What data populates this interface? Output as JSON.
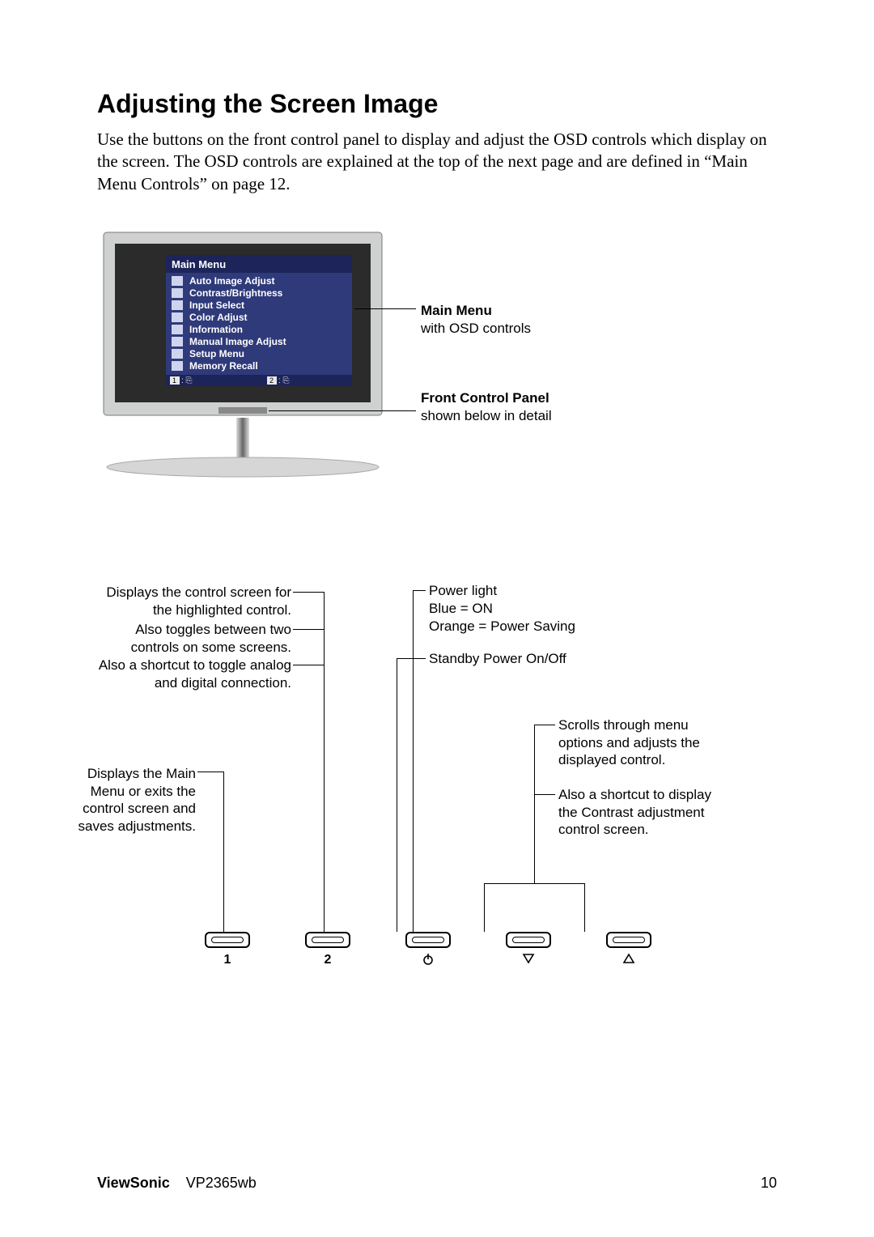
{
  "title": "Adjusting the Screen Image",
  "intro": "Use the buttons on the front control panel to display and adjust the OSD controls which display on the screen. The OSD controls are explained at the top of the next page and are defined in “Main Menu Controls” on page 12.",
  "osd": {
    "header": "Main Menu",
    "items": [
      "Auto Image Adjust",
      "Contrast/Brightness",
      "Input Select",
      "Color Adjust",
      "Information",
      "Manual Image Adjust",
      "Setup Menu",
      "Memory Recall"
    ],
    "hint1": "1",
    "hint2": "2"
  },
  "callouts": {
    "mainMenu": {
      "label": "Main Menu",
      "sub": "with OSD controls"
    },
    "frontPanel": {
      "label": "Front Control Panel",
      "sub": "shown below in detail"
    }
  },
  "annotations": {
    "btn2_a": "Displays the control screen for the highlighted control.",
    "btn2_b": "Also toggles between two controls on some screens.",
    "btn2_c": "Also a shortcut to toggle analog and digital connection.",
    "btn1": "Displays the Main Menu or exits the control screen and saves adjustments.",
    "power_a": "Power light",
    "power_b": "Blue = ON",
    "power_c": "Orange = Power Saving",
    "standby": "Standby Power On/Off",
    "scroll_a": "Scrolls through menu options and adjusts the displayed control.",
    "scroll_b": "Also a shortcut to display the Contrast adjustment control screen."
  },
  "buttons": {
    "b1": "1",
    "b2": "2"
  },
  "footer": {
    "brand": "ViewSonic",
    "model": "VP2365wb",
    "page": "10"
  }
}
